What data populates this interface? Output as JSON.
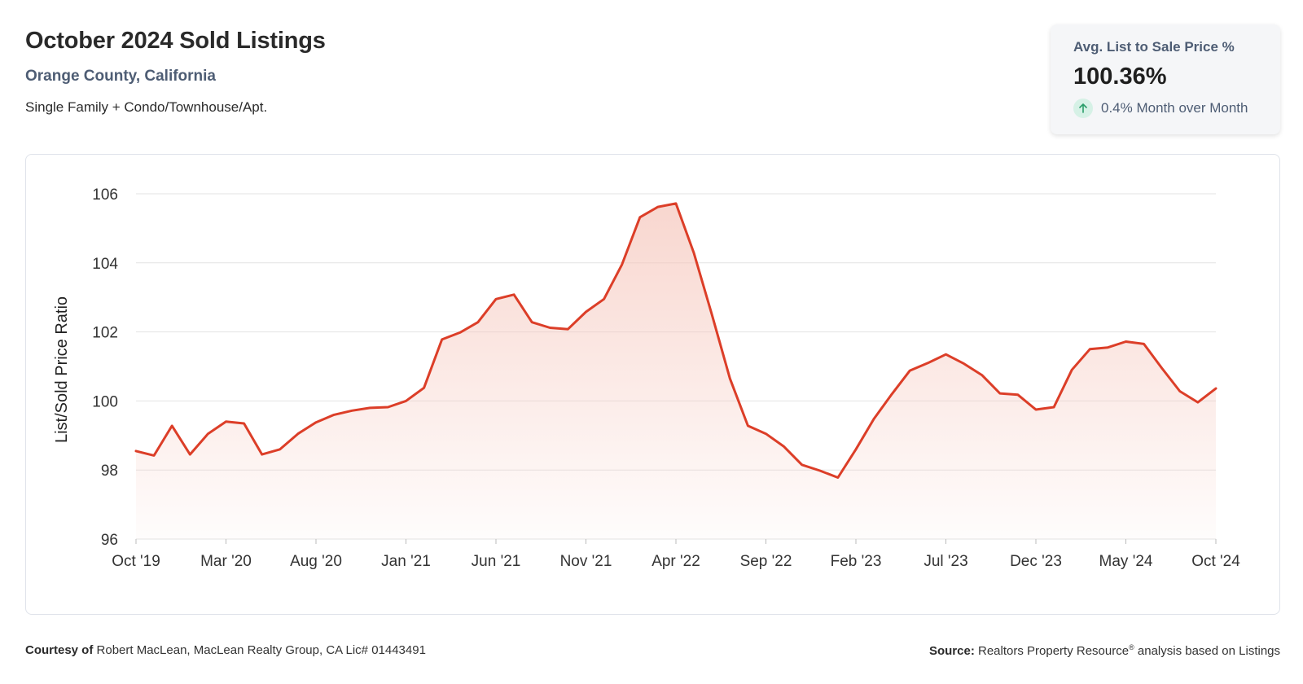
{
  "header": {
    "title": "October 2024 Sold Listings",
    "subtitle": "Orange County, California",
    "description": "Single Family + Condo/Townhouse/Apt."
  },
  "kpi": {
    "label": "Avg. List to Sale Price %",
    "value": "100.36%",
    "change": "0.4% Month over Month",
    "icon": "arrow-up-icon",
    "icon_color": "#2a9d6a"
  },
  "footer": {
    "courtesy_label": "Courtesy of",
    "courtesy_text": "Robert MacLean, MacLean Realty Group, CA Lic# 01443491",
    "source_label": "Source:",
    "source_text": "Realtors Property Resource",
    "source_reg": "®",
    "source_suffix": "analysis based on Listings"
  },
  "chart_data": {
    "type": "area",
    "ylabel": "List/Sold Price Ratio",
    "ylim": [
      96,
      106
    ],
    "yticks": [
      96,
      98,
      100,
      102,
      104,
      106
    ],
    "grid": true,
    "line_color": "#dc3e28",
    "fill_color": "#f6c9bf",
    "xtick_labels": [
      "Oct '19",
      "Mar '20",
      "Aug '20",
      "Jan '21",
      "Jun '21",
      "Nov '21",
      "Apr '22",
      "Sep '22",
      "Feb '23",
      "Jul '23",
      "Dec '23",
      "May '24",
      "Oct '24"
    ],
    "xtick_every": 5,
    "values": [
      98.55,
      98.42,
      99.28,
      98.45,
      99.05,
      99.4,
      99.35,
      98.45,
      98.6,
      99.05,
      99.38,
      99.6,
      99.72,
      99.8,
      99.82,
      100.0,
      100.38,
      101.78,
      101.98,
      102.28,
      102.95,
      103.08,
      102.28,
      102.12,
      102.08,
      102.58,
      102.95,
      103.95,
      105.32,
      105.62,
      105.72,
      104.28,
      102.5,
      100.65,
      99.28,
      99.05,
      98.68,
      98.15,
      97.98,
      97.78,
      98.6,
      99.48,
      100.2,
      100.88,
      101.1,
      101.35,
      101.08,
      100.75,
      100.22,
      100.18,
      99.75,
      99.82,
      100.9,
      101.5,
      101.55,
      101.72,
      101.65,
      100.95,
      100.28,
      99.96,
      100.36
    ]
  }
}
